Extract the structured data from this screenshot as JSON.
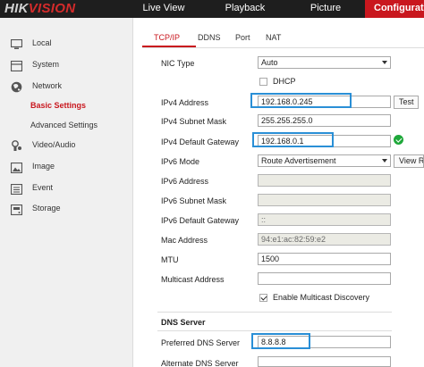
{
  "app": {
    "logo_main": "HIK",
    "logo_accent": "VISION"
  },
  "topnav": {
    "items": [
      {
        "label": "Live View"
      },
      {
        "label": "Playback"
      },
      {
        "label": "Picture"
      },
      {
        "label": "Configuratio"
      }
    ],
    "active_index": 3
  },
  "sidebar": {
    "items": [
      {
        "label": "Local",
        "icon": "monitor-icon"
      },
      {
        "label": "System",
        "icon": "system-icon"
      },
      {
        "label": "Network",
        "icon": "globe-icon"
      },
      {
        "label": "Basic Settings",
        "sub": true,
        "active": true
      },
      {
        "label": "Advanced Settings",
        "sub": true
      },
      {
        "label": "Video/Audio",
        "icon": "video-audio-icon"
      },
      {
        "label": "Image",
        "icon": "image-icon"
      },
      {
        "label": "Event",
        "icon": "event-icon"
      },
      {
        "label": "Storage",
        "icon": "storage-icon"
      }
    ]
  },
  "tabs": [
    {
      "label": "TCP/IP",
      "active": true
    },
    {
      "label": "DDNS"
    },
    {
      "label": "Port"
    },
    {
      "label": "NAT"
    }
  ],
  "form": {
    "nic_type": {
      "label": "NIC Type",
      "value": "Auto"
    },
    "dhcp": {
      "label": "DHCP",
      "checked": false
    },
    "ipv4_address": {
      "label": "IPv4 Address",
      "value": "192.168.0.245",
      "button": "Test"
    },
    "ipv4_subnet": {
      "label": "IPv4 Subnet Mask",
      "value": "255.255.255.0"
    },
    "ipv4_gateway": {
      "label": "IPv4 Default Gateway",
      "value": "192.168.0.1"
    },
    "ipv6_mode": {
      "label": "IPv6 Mode",
      "value": "Route Advertisement",
      "button": "View R"
    },
    "ipv6_address": {
      "label": "IPv6 Address",
      "value": ""
    },
    "ipv6_subnet": {
      "label": "IPv6 Subnet Mask",
      "value": ""
    },
    "ipv6_gateway": {
      "label": "IPv6 Default Gateway",
      "value": "::"
    },
    "mac_address": {
      "label": "Mac Address",
      "value": "94:e1:ac:82:59:e2"
    },
    "mtu": {
      "label": "MTU",
      "value": "1500"
    },
    "multicast": {
      "label": "Multicast Address",
      "value": ""
    },
    "multicast_discovery": {
      "label": "Enable Multicast Discovery",
      "checked": true
    }
  },
  "dns": {
    "title": "DNS Server",
    "preferred": {
      "label": "Preferred DNS Server",
      "value": "8.8.8.8"
    },
    "alternate": {
      "label": "Alternate DNS Server",
      "value": ""
    }
  },
  "colors": {
    "accent": "#c9171e",
    "highlight": "#2a8fd6",
    "topbar": "#1e1e1e",
    "ok": "#1fa83a"
  }
}
